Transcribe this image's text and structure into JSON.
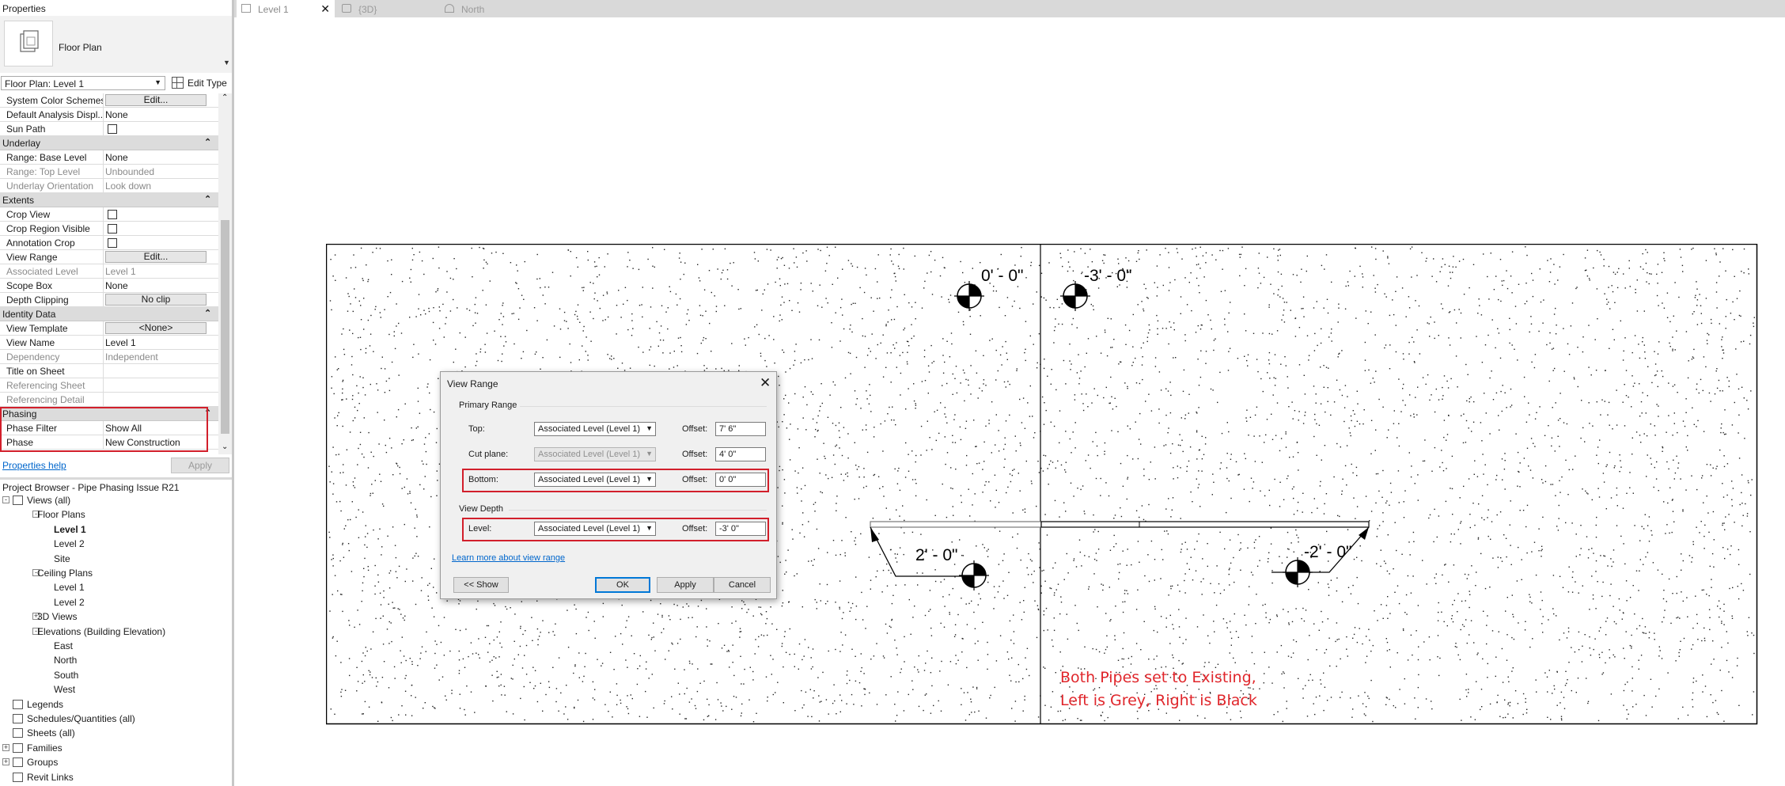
{
  "properties": {
    "panel_title": "Properties",
    "type_name": "Floor Plan",
    "view_selector": "Floor Plan: Level 1",
    "edit_type_label": "Edit Type",
    "rows": [
      {
        "kind": "param",
        "key": "System Color Schemes",
        "button": "Edit..."
      },
      {
        "kind": "param",
        "key": "Default Analysis Displ...",
        "value": "None"
      },
      {
        "kind": "param",
        "key": "Sun Path",
        "checkbox": true
      },
      {
        "kind": "category",
        "key": "Underlay"
      },
      {
        "kind": "param",
        "key": "Range: Base Level",
        "value": "None"
      },
      {
        "kind": "param",
        "key": "Range: Top Level",
        "value": "Unbounded",
        "disabled": true
      },
      {
        "kind": "param",
        "key": "Underlay Orientation",
        "value": "Look down",
        "disabled": true
      },
      {
        "kind": "category",
        "key": "Extents"
      },
      {
        "kind": "param",
        "key": "Crop View",
        "checkbox": true
      },
      {
        "kind": "param",
        "key": "Crop Region Visible",
        "checkbox": true
      },
      {
        "kind": "param",
        "key": "Annotation Crop",
        "checkbox": true
      },
      {
        "kind": "param",
        "key": "View Range",
        "button": "Edit..."
      },
      {
        "kind": "param",
        "key": "Associated Level",
        "value": "Level 1",
        "disabled": true
      },
      {
        "kind": "param",
        "key": "Scope Box",
        "value": "None"
      },
      {
        "kind": "param",
        "key": "Depth Clipping",
        "button": "No clip"
      },
      {
        "kind": "category",
        "key": "Identity Data"
      },
      {
        "kind": "param",
        "key": "View Template",
        "button": "<None>"
      },
      {
        "kind": "param",
        "key": "View Name",
        "value": "Level 1"
      },
      {
        "kind": "param",
        "key": "Dependency",
        "value": "Independent",
        "disabled": true
      },
      {
        "kind": "param",
        "key": "Title on Sheet",
        "value": ""
      },
      {
        "kind": "param",
        "key": "Referencing Sheet",
        "value": "",
        "disabled": true
      },
      {
        "kind": "param",
        "key": "Referencing Detail",
        "value": "",
        "disabled": true
      },
      {
        "kind": "category",
        "key": "Phasing"
      },
      {
        "kind": "param",
        "key": "Phase Filter",
        "value": "Show All"
      },
      {
        "kind": "param",
        "key": "Phase",
        "value": "New Construction"
      }
    ],
    "help_link": "Properties help",
    "apply_label": "Apply"
  },
  "project_browser": {
    "title": "Project Browser - Pipe Phasing Issue R21",
    "nodes": [
      {
        "label": "Views (all)",
        "level": 0,
        "expander": "-",
        "icon": "views-icon"
      },
      {
        "label": "Floor Plans",
        "level": 1,
        "expander": "-"
      },
      {
        "label": "Level 1",
        "level": 2,
        "bold": true
      },
      {
        "label": "Level 2",
        "level": 2
      },
      {
        "label": "Site",
        "level": 2
      },
      {
        "label": "Ceiling Plans",
        "level": 1,
        "expander": "-"
      },
      {
        "label": "Level 1",
        "level": 2
      },
      {
        "label": "Level 2",
        "level": 2
      },
      {
        "label": "3D Views",
        "level": 1,
        "expander": "+"
      },
      {
        "label": "Elevations (Building Elevation)",
        "level": 1,
        "expander": "-"
      },
      {
        "label": "East",
        "level": 2
      },
      {
        "label": "North",
        "level": 2
      },
      {
        "label": "South",
        "level": 2
      },
      {
        "label": "West",
        "level": 2
      },
      {
        "label": "Legends",
        "level": 0,
        "icon": "legends-icon"
      },
      {
        "label": "Schedules/Quantities (all)",
        "level": 0,
        "icon": "schedules-icon"
      },
      {
        "label": "Sheets (all)",
        "level": 0,
        "icon": "sheets-icon"
      },
      {
        "label": "Families",
        "level": 0,
        "expander": "+",
        "icon": "families-icon"
      },
      {
        "label": "Groups",
        "level": 0,
        "expander": "+",
        "icon": "groups-icon"
      },
      {
        "label": "Revit Links",
        "level": 0,
        "icon": "revit-links-icon"
      }
    ]
  },
  "tabs": [
    {
      "label": "Level 1",
      "active": true,
      "close": "✕"
    },
    {
      "label": "{3D}",
      "active": false
    },
    {
      "label": "North",
      "active": false
    }
  ],
  "drawing": {
    "elevation_tags": [
      "0' - 0\"",
      "-3' - 0\"",
      "2' - 0\"",
      "-2' - 0\""
    ],
    "note_lines": [
      "Both Pipes set to Existing,",
      "Left is Grey, Right is Black"
    ],
    "note_color": "#e0262b"
  },
  "view_range_dialog": {
    "title": "View Range",
    "close": "✕",
    "primary_range_label": "Primary Range",
    "view_depth_label": "View Depth",
    "offset_label": "Offset:",
    "rows": [
      {
        "label": "Top:",
        "level": "Associated Level (Level 1)",
        "offset": "7'  6\"",
        "disabled": false
      },
      {
        "label": "Cut plane:",
        "level": "Associated Level (Level 1)",
        "offset": "4'  0\"",
        "disabled": true
      },
      {
        "label": "Bottom:",
        "level": "Associated Level (Level 1)",
        "offset": "0'  0\"",
        "disabled": false
      },
      {
        "label": "Level:",
        "level": "Associated Level (Level 1)",
        "offset": "-3'  0\"",
        "disabled": false
      }
    ],
    "learn_more": "Learn more about view range",
    "show_button": "<< Show",
    "ok_button": "OK",
    "apply_button": "Apply",
    "cancel_button": "Cancel"
  },
  "highlight_color": "#d21f2b"
}
